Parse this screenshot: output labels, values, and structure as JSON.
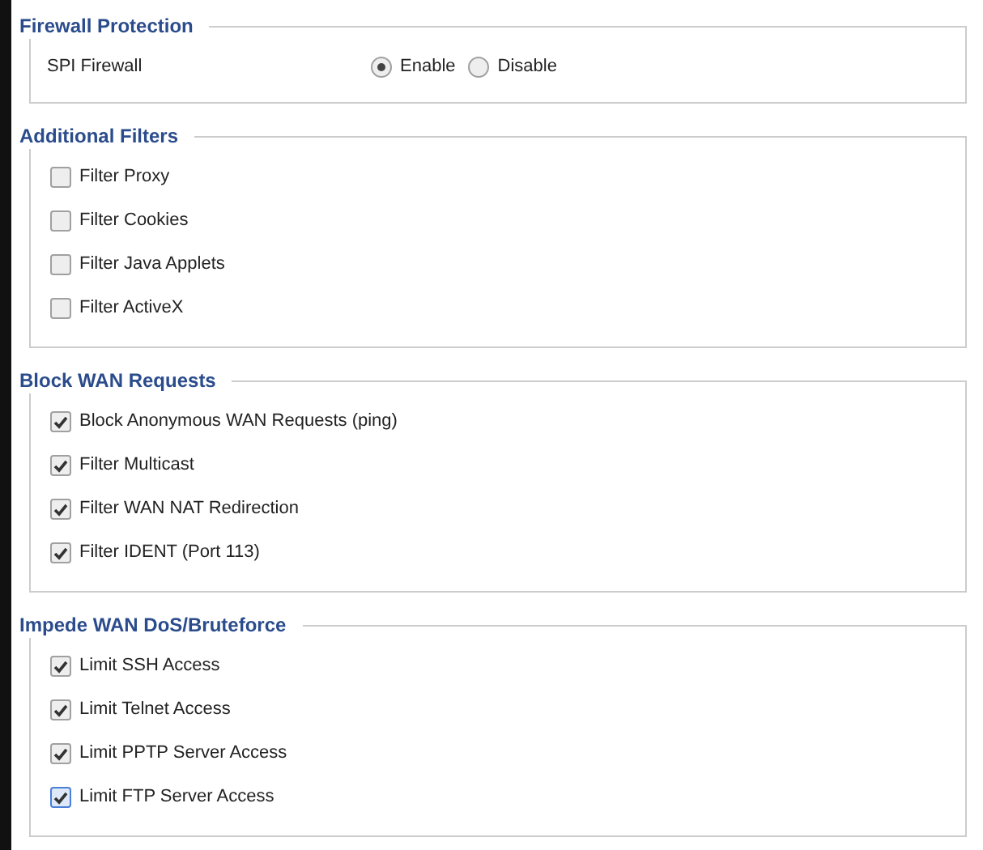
{
  "sections": [
    {
      "title": "Firewall Protection",
      "kind": "radio",
      "label": "SPI Firewall",
      "options": [
        {
          "label": "Enable",
          "selected": true
        },
        {
          "label": "Disable",
          "selected": false
        }
      ]
    },
    {
      "title": "Additional Filters",
      "kind": "checkbox",
      "items": [
        {
          "label": "Filter Proxy",
          "checked": false,
          "focused": false
        },
        {
          "label": "Filter Cookies",
          "checked": false,
          "focused": false
        },
        {
          "label": "Filter Java Applets",
          "checked": false,
          "focused": false
        },
        {
          "label": "Filter ActiveX",
          "checked": false,
          "focused": false
        }
      ]
    },
    {
      "title": "Block WAN Requests",
      "kind": "checkbox",
      "items": [
        {
          "label": "Block Anonymous WAN Requests (ping)",
          "checked": true,
          "focused": false
        },
        {
          "label": "Filter Multicast",
          "checked": true,
          "focused": false
        },
        {
          "label": "Filter WAN NAT Redirection",
          "checked": true,
          "focused": false
        },
        {
          "label": "Filter IDENT (Port 113)",
          "checked": true,
          "focused": false
        }
      ]
    },
    {
      "title": "Impede WAN DoS/Bruteforce",
      "kind": "checkbox",
      "items": [
        {
          "label": "Limit SSH Access",
          "checked": true,
          "focused": false
        },
        {
          "label": "Limit Telnet Access",
          "checked": true,
          "focused": false
        },
        {
          "label": "Limit PPTP Server Access",
          "checked": true,
          "focused": false
        },
        {
          "label": "Limit FTP Server Access",
          "checked": true,
          "focused": true
        }
      ]
    }
  ]
}
